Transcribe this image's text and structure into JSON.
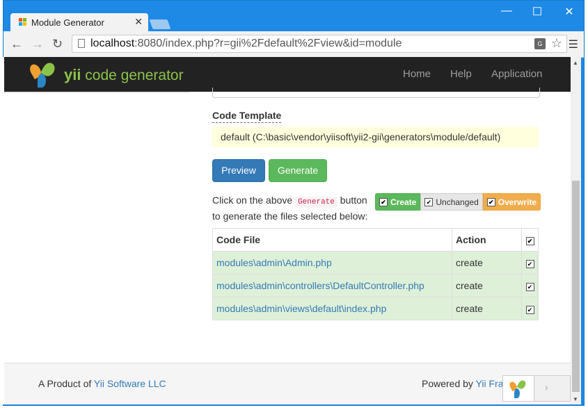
{
  "browser": {
    "tab_title": "Module Generator",
    "tab_close": "✕",
    "url_host": "localhost",
    "url_rest": ":8080/index.php?r=gii%2Fdefault%2Fview&id=module",
    "window_controls": {
      "minimize": "—",
      "maximize": "☐",
      "close": "✕"
    },
    "nav": {
      "back": "←",
      "forward": "→",
      "reload": "↻"
    },
    "icons": {
      "translate": "G",
      "star": "☆",
      "menu": "☰"
    }
  },
  "navbar": {
    "brand_yii": "yii",
    "brand_rest": " code generator",
    "items": [
      {
        "label": "Home"
      },
      {
        "label": "Help"
      },
      {
        "label": "Application"
      }
    ]
  },
  "form": {
    "code_template_label": "Code Template",
    "code_template_value": "default (C:\\basic\\vendor\\yiisoft\\yii2-gii\\generators\\module/default)",
    "preview_button": "Preview",
    "generate_button": "Generate"
  },
  "hint": {
    "before": "Click on the above ",
    "code": "Generate",
    "after_line1": " button",
    "line2": "to generate the files selected below:"
  },
  "legend": {
    "create": "Create",
    "unchanged": "Unchanged",
    "overwrite": "Overwrite"
  },
  "files_table": {
    "headers": {
      "file": "Code File",
      "action": "Action"
    },
    "rows": [
      {
        "file": "modules\\admin\\Admin.php",
        "action": "create"
      },
      {
        "file": "modules\\admin\\controllers\\DefaultController.php",
        "action": "create"
      },
      {
        "file": "modules\\admin\\views\\default\\index.php",
        "action": "create"
      }
    ]
  },
  "footer": {
    "left_prefix": "A Product of ",
    "left_link": "Yii Software LLC",
    "right_prefix": "Powered by ",
    "right_link": "Yii Fra"
  },
  "colors": {
    "primary": "#337ab7",
    "success": "#5cb85c",
    "warning": "#f0ad4e",
    "row_create": "#dff0d8",
    "navbar": "#222222",
    "brand_green": "#8bc34a"
  },
  "check_mark": "✔",
  "float_widget_arrow": "›"
}
